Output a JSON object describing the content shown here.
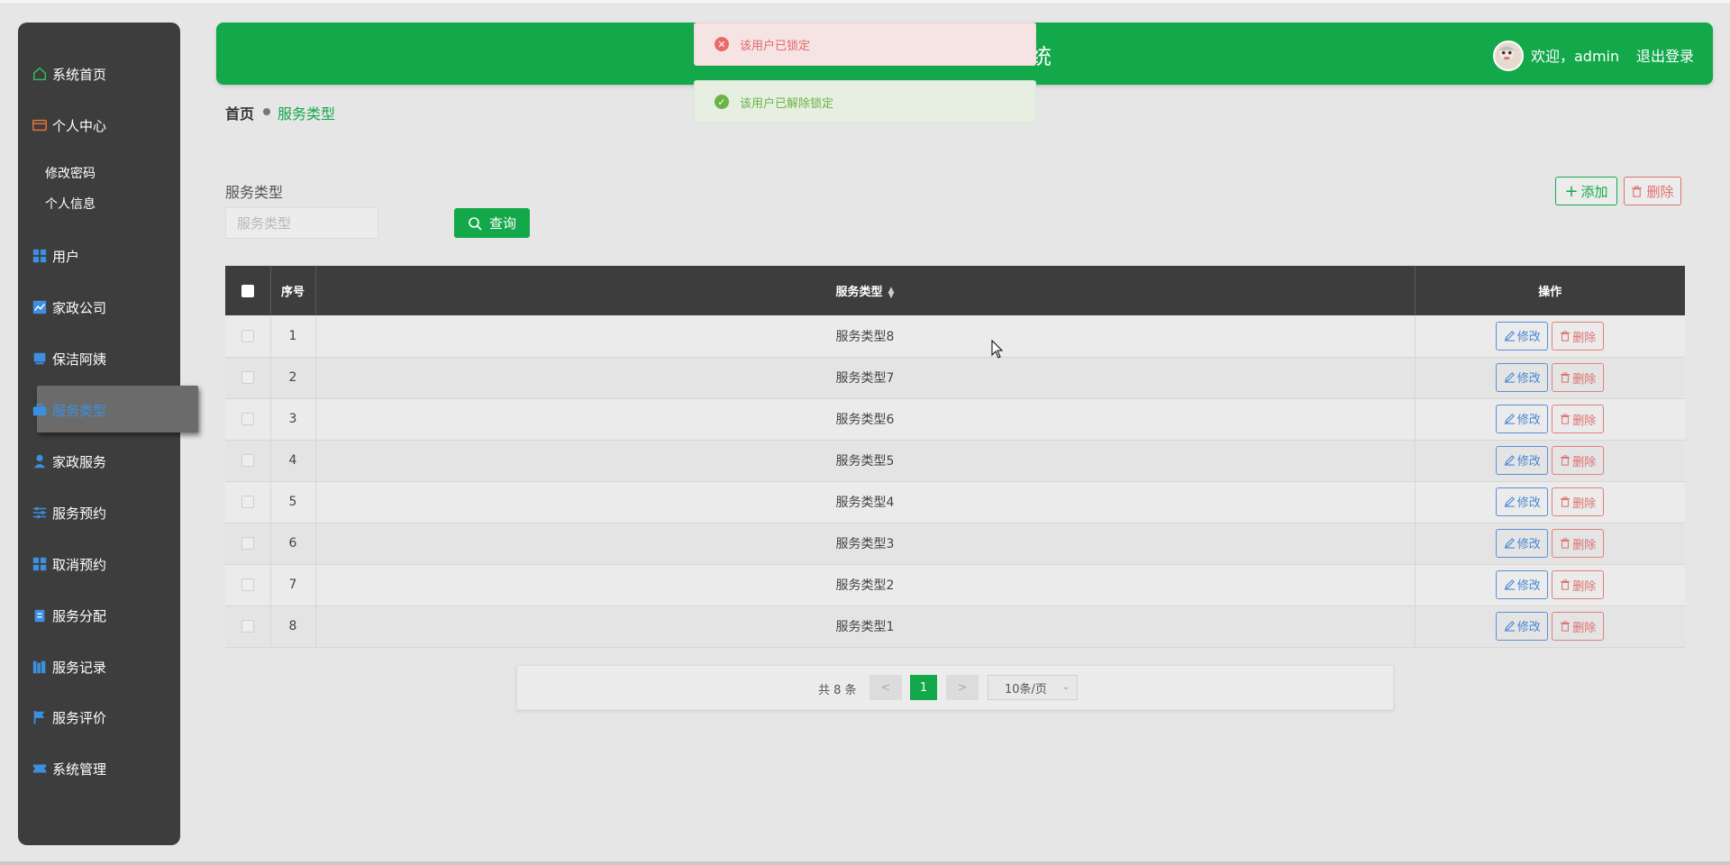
{
  "sidebar": {
    "items": [
      {
        "label": "系统首页"
      },
      {
        "label": "个人中心"
      },
      {
        "label": "用户"
      },
      {
        "label": "家政公司"
      },
      {
        "label": "保洁阿姨"
      },
      {
        "label": "服务类型"
      },
      {
        "label": "家政服务"
      },
      {
        "label": "服务预约"
      },
      {
        "label": "取消预约"
      },
      {
        "label": "服务分配"
      },
      {
        "label": "服务记录"
      },
      {
        "label": "服务评价"
      },
      {
        "label": "系统管理"
      }
    ],
    "sub_items": [
      {
        "label": "修改密码"
      },
      {
        "label": "个人信息"
      }
    ]
  },
  "header": {
    "title_fragment": "统",
    "welcome": "欢迎，admin",
    "logout": "退出登录"
  },
  "toasts": {
    "error": "该用户已锁定",
    "success": "该用户已解除锁定"
  },
  "breadcrumb": {
    "home": "首页",
    "current": "服务类型"
  },
  "search": {
    "label": "服务类型",
    "placeholder": "服务类型",
    "button": "查询"
  },
  "actions": {
    "add": "添加",
    "delete": "删除"
  },
  "table": {
    "headers": {
      "index": "序号",
      "type": "服务类型",
      "ops": "操作"
    },
    "rows": [
      {
        "index": "1",
        "type": "服务类型8"
      },
      {
        "index": "2",
        "type": "服务类型7"
      },
      {
        "index": "3",
        "type": "服务类型6"
      },
      {
        "index": "4",
        "type": "服务类型5"
      },
      {
        "index": "5",
        "type": "服务类型4"
      },
      {
        "index": "6",
        "type": "服务类型3"
      },
      {
        "index": "7",
        "type": "服务类型2"
      },
      {
        "index": "8",
        "type": "服务类型1"
      }
    ],
    "edit_label": "修改",
    "delete_label": "删除"
  },
  "pagination": {
    "total": "共 8 条",
    "prev": "<",
    "next": ">",
    "current_page": "1",
    "page_size": "10条/页"
  },
  "colors": {
    "accent": "#13a84a",
    "sidebar_bg": "#3d3d3d",
    "active_menu_text": "#3d8fe0",
    "danger": "#e07070"
  }
}
